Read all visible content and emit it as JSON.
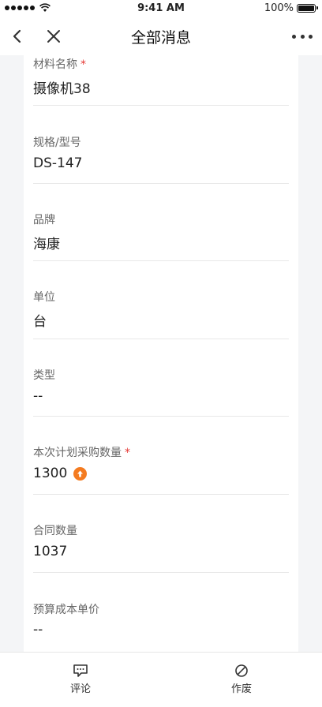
{
  "status_bar": {
    "time": "9:41 AM",
    "battery": "100%"
  },
  "nav": {
    "title": "全部消息"
  },
  "fields": [
    {
      "label": "材料名称",
      "required": true,
      "value": "摄像机38"
    },
    {
      "label": "规格/型号",
      "required": false,
      "value": "DS-147"
    },
    {
      "label": "品牌",
      "required": false,
      "value": "海康"
    },
    {
      "label": "单位",
      "required": false,
      "value": "台"
    },
    {
      "label": "类型",
      "required": false,
      "value": "--"
    },
    {
      "label": "本次计划采购数量",
      "required": true,
      "value": "1300",
      "badge": "arrow-up-icon"
    },
    {
      "label": "合同数量",
      "required": false,
      "value": "1037"
    },
    {
      "label": "预算成本单价",
      "required": false,
      "value": "--"
    }
  ],
  "required_mark": "*",
  "bottom_bar": {
    "comment_label": "评论",
    "void_label": "作废"
  },
  "colors": {
    "required": "#e53935",
    "badge": "#f47b20"
  }
}
